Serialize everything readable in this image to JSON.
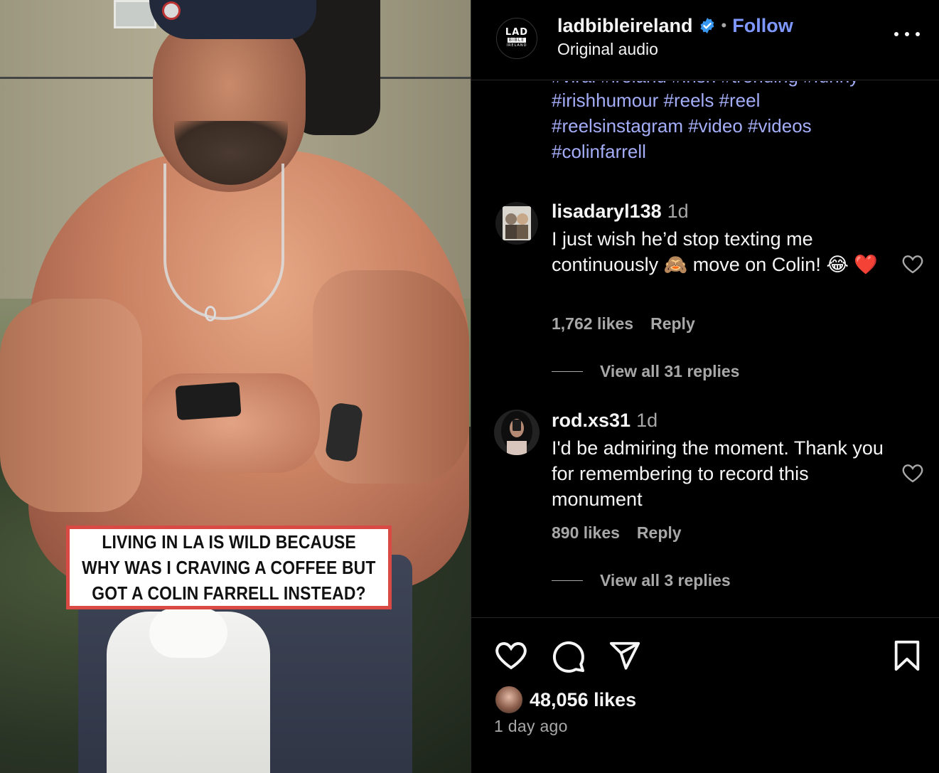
{
  "media": {
    "caption_lines": [
      "LIVING IN LA IS WILD BECAUSE",
      "WHY WAS I CRAVING A COFFEE BUT",
      "GOT A COLIN FARRELL INSTEAD?"
    ],
    "caption_border_color": "#d84a43"
  },
  "header": {
    "logo_lines": [
      "LAD",
      "BIBLE",
      "IRELAND"
    ],
    "account_name": "ladbibleireland",
    "verified_icon": "verified-badge-icon",
    "separator": "•",
    "follow_label": "Follow",
    "audio_label": "Original audio",
    "more_icon": "more-options-icon"
  },
  "caption_hashtags": {
    "lines": [
      "#viral #ireland #irish #trending #funny",
      "#irishhumour #reels #reel",
      "#reelsinstagram #video #videos",
      "#colinfarrell"
    ],
    "color": "#a4adf7"
  },
  "comments": [
    {
      "username": "lisadaryl138",
      "age": "1d",
      "text_parts": [
        "I just wish he’d stop texting me continuously ",
        "🙈",
        " move on Colin! ",
        "😂",
        " ",
        "❤️"
      ],
      "likes": "1,762 likes",
      "reply_label": "Reply",
      "view_replies": "View all 31 replies"
    },
    {
      "username": "rod.xs31",
      "age": "1d",
      "text": "I'd be admiring the moment. Thank you for remembering to record this monument",
      "likes": "890 likes",
      "reply_label": "Reply",
      "view_replies": "View all 3 replies"
    }
  ],
  "actions": {
    "like_icon": "heart-icon",
    "comment_icon": "comment-icon",
    "share_icon": "share-icon",
    "save_icon": "bookmark-icon",
    "likes_count": "48,056 likes",
    "time_ago": "1 day ago"
  },
  "colors": {
    "background": "#000000",
    "link_blue": "#7f98ff",
    "secondary_text": "#a8a8a8",
    "primary_text": "#f5f5f5",
    "divider": "#262626"
  }
}
